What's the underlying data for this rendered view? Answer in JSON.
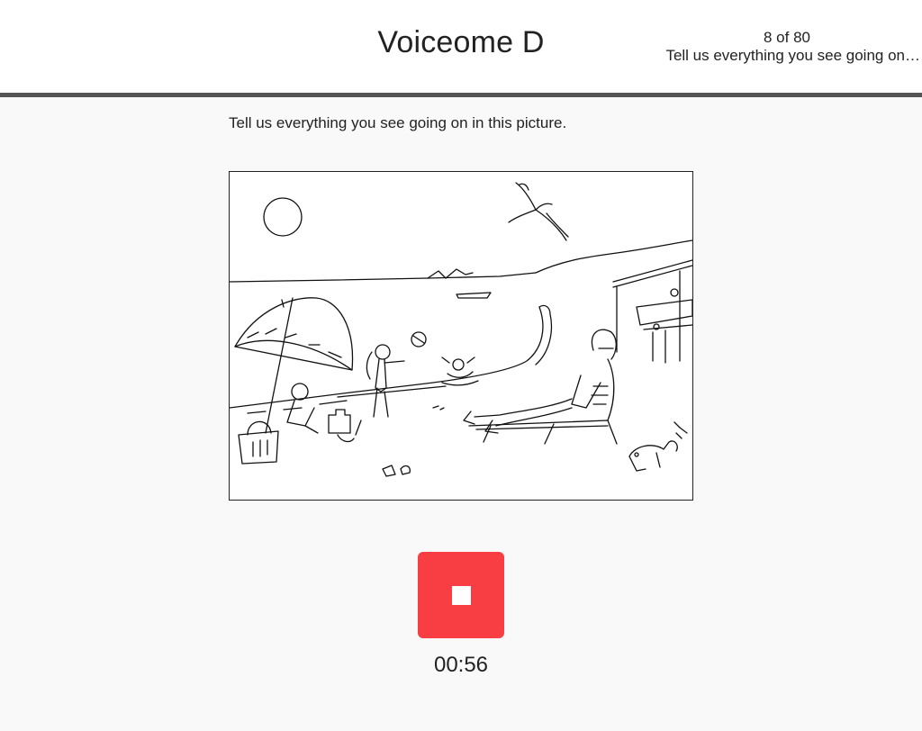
{
  "header": {
    "title": "Voiceome D",
    "progress": {
      "count": "8 of 80",
      "task": "Tell us everything you see going on…"
    }
  },
  "main": {
    "prompt": "Tell us everything you see going on in this picture."
  },
  "recorder": {
    "stop_icon": "stop-square-icon",
    "accent_color": "#f93e43",
    "elapsed": "00:56"
  }
}
